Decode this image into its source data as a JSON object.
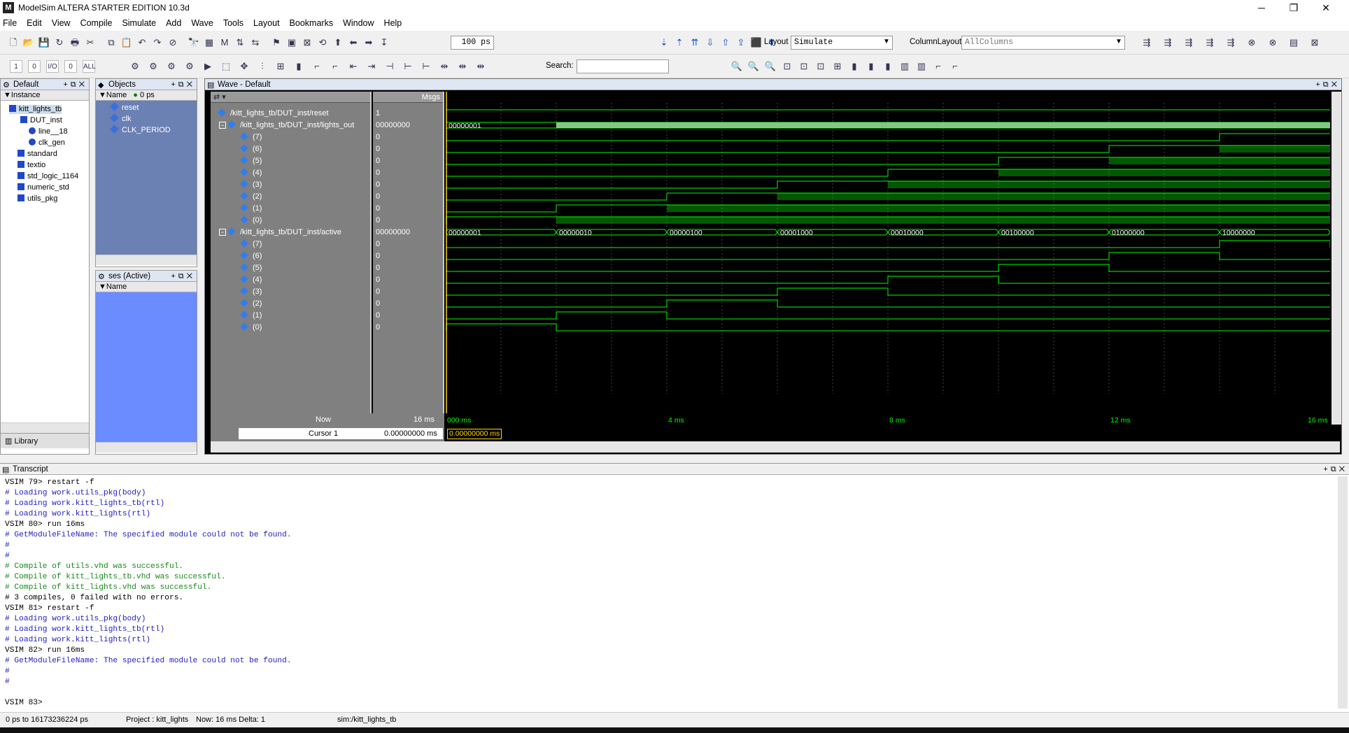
{
  "window": {
    "title": "ModelSim ALTERA STARTER EDITION 10.3d",
    "logo_text": "M",
    "controls": {
      "minimize": "─",
      "restore": "❐",
      "close": "✕"
    }
  },
  "menu": [
    "File",
    "Edit",
    "View",
    "Compile",
    "Simulate",
    "Add",
    "Wave",
    "Tools",
    "Layout",
    "Bookmarks",
    "Window",
    "Help"
  ],
  "toolbar1": {
    "run_length": "100 ps",
    "layout_label": "Layout",
    "layout_value": "Simulate",
    "column_layout_label": "ColumnLayout",
    "column_layout_value": "AllColumns"
  },
  "toolbar2": {
    "search_label": "Search:",
    "search_value": "",
    "small_labels": [
      "1",
      "0",
      "I/O",
      "0",
      "ALL"
    ]
  },
  "instance_pane": {
    "title": "Default",
    "column": "Instance",
    "items": [
      {
        "label": "kitt_lights_tb",
        "icon": "square",
        "selected": true
      },
      {
        "label": "DUT_inst",
        "icon": "square"
      },
      {
        "label": "line__18",
        "icon": "circle"
      },
      {
        "label": "clk_gen",
        "icon": "circle"
      },
      {
        "label": "standard",
        "icon": "square"
      },
      {
        "label": "textio",
        "icon": "square"
      },
      {
        "label": "std_logic_1164",
        "icon": "square"
      },
      {
        "label": "numeric_std",
        "icon": "square"
      },
      {
        "label": "utils_pkg",
        "icon": "square"
      }
    ],
    "tabs": [
      "Library"
    ]
  },
  "objects_pane": {
    "title": "Objects",
    "column": "Name",
    "time_field": "0 ps",
    "items": [
      "reset",
      "clk",
      "CLK_PERIOD"
    ]
  },
  "processes_pane": {
    "title": "ses (Active)",
    "column": "Name"
  },
  "wave": {
    "title": "Wave - Default",
    "msgs_header": "Msgs",
    "signals": [
      {
        "name": "/kitt_lights_tb/DUT_inst/reset",
        "value": "1",
        "level": 0
      },
      {
        "name": "/kitt_lights_tb/DUT_inst/lights_out",
        "value": "00000000",
        "level": 0,
        "expand": "−"
      },
      {
        "name": "(7)",
        "value": "0",
        "level": 1
      },
      {
        "name": "(6)",
        "value": "0",
        "level": 1
      },
      {
        "name": "(5)",
        "value": "0",
        "level": 1
      },
      {
        "name": "(4)",
        "value": "0",
        "level": 1
      },
      {
        "name": "(3)",
        "value": "0",
        "level": 1
      },
      {
        "name": "(2)",
        "value": "0",
        "level": 1
      },
      {
        "name": "(1)",
        "value": "0",
        "level": 1
      },
      {
        "name": "(0)",
        "value": "0",
        "level": 1
      },
      {
        "name": "/kitt_lights_tb/DUT_inst/active",
        "value": "00000000",
        "level": 0,
        "expand": "−"
      },
      {
        "name": "(7)",
        "value": "0",
        "level": 1
      },
      {
        "name": "(6)",
        "value": "0",
        "level": 1
      },
      {
        "name": "(5)",
        "value": "0",
        "level": 1
      },
      {
        "name": "(4)",
        "value": "0",
        "level": 1
      },
      {
        "name": "(3)",
        "value": "0",
        "level": 1
      },
      {
        "name": "(2)",
        "value": "0",
        "level": 1
      },
      {
        "name": "(1)",
        "value": "0",
        "level": 1
      },
      {
        "name": "(0)",
        "value": "0",
        "level": 1
      }
    ],
    "bus_labels_lights": [
      "00000001"
    ],
    "bus_labels_active": [
      "00000001",
      "00000010",
      "00000100",
      "00001000",
      "00010000",
      "00100000",
      "01000000",
      "10000000"
    ],
    "now_label": "Now",
    "now_value": "16 ms",
    "cursor_label": "Cursor 1",
    "cursor_value": "0.00000000 ms",
    "cursor_readout": "0.00000000 ms",
    "time_axis": [
      "000 ms",
      "4 ms",
      "8 ms",
      "12 ms",
      "16 ms"
    ],
    "colors": {
      "wave": "#00ff00",
      "cursor": "#ffd700",
      "bg": "#000000"
    }
  },
  "transcript": {
    "title": "Transcript",
    "lines": [
      {
        "t": "cmd",
        "text": "VSIM 79> restart -f"
      },
      {
        "t": "info",
        "text": "# Loading work.utils_pkg(body)"
      },
      {
        "t": "info",
        "text": "# Loading work.kitt_lights_tb(rtl)"
      },
      {
        "t": "info",
        "text": "# Loading work.kitt_lights(rtl)"
      },
      {
        "t": "cmd",
        "text": "VSIM 80> run 16ms"
      },
      {
        "t": "info",
        "text": "# GetModuleFileName: The specified module could not be found."
      },
      {
        "t": "info",
        "text": "#"
      },
      {
        "t": "info",
        "text": "#"
      },
      {
        "t": "ok",
        "text": "# Compile of utils.vhd was successful."
      },
      {
        "t": "ok",
        "text": "# Compile of kitt_lights_tb.vhd was successful."
      },
      {
        "t": "ok",
        "text": "# Compile of kitt_lights.vhd was successful."
      },
      {
        "t": "cmd",
        "text": "# 3 compiles, 0 failed with no errors."
      },
      {
        "t": "cmd",
        "text": "VSIM 81> restart -f"
      },
      {
        "t": "info",
        "text": "# Loading work.utils_pkg(body)"
      },
      {
        "t": "info",
        "text": "# Loading work.kitt_lights_tb(rtl)"
      },
      {
        "t": "info",
        "text": "# Loading work.kitt_lights(rtl)"
      },
      {
        "t": "cmd",
        "text": "VSIM 82> run 16ms"
      },
      {
        "t": "info",
        "text": "# GetModuleFileName: The specified module could not be found."
      },
      {
        "t": "info",
        "text": "#"
      },
      {
        "t": "info",
        "text": "#"
      },
      {
        "t": "cmd",
        "text": ""
      },
      {
        "t": "cmd",
        "text": "VSIM 83>"
      }
    ]
  },
  "status": {
    "range": "0 ps to 16173236224 ps",
    "project": "Project : kitt_lights",
    "now": "Now: 16 ms  Delta: 1",
    "sim": "sim:/kitt_lights_tb"
  }
}
